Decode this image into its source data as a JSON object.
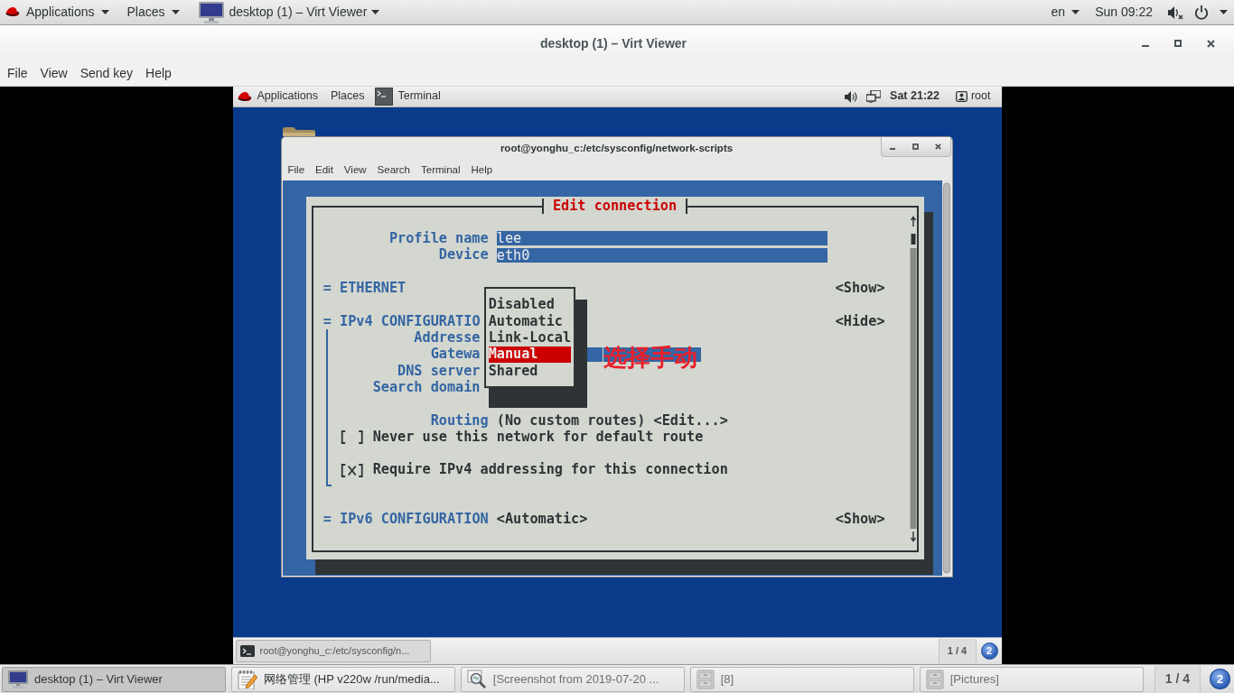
{
  "top_bar": {
    "applications": "Applications",
    "places": "Places",
    "window_menu": "desktop (1) – Virt Viewer",
    "keyboard": "en",
    "clock": "Sun 09:22"
  },
  "window": {
    "title": "desktop (1) – Virt Viewer",
    "menu": [
      "File",
      "View",
      "Send key",
      "Help"
    ]
  },
  "guest": {
    "top_bar": {
      "applications": "Applications",
      "places": "Places",
      "window_menu": "Terminal",
      "clock": "Sat 21:22",
      "user": "root"
    },
    "terminal": {
      "title": "root@yonghu_c:/etc/sysconfig/network-scripts",
      "menu": [
        "File",
        "Edit",
        "View",
        "Search",
        "Terminal",
        "Help"
      ],
      "dialog": {
        "title": "Edit connection",
        "fields": [
          {
            "label": "Profile name",
            "value": "lee"
          },
          {
            "label": "Device",
            "value": "eth0"
          }
        ],
        "ethernet": {
          "marker": "=",
          "label": "ETHERNET",
          "toggle": "<Show>"
        },
        "ipv4": {
          "marker": "=",
          "label": "IPv4 CONFIGURATIO",
          "toggle": "<Hide>",
          "rows": [
            {
              "kind": "label",
              "label": "Addresse"
            },
            {
              "kind": "field",
              "label": "Gatewa"
            },
            {
              "kind": "label",
              "label": "DNS server"
            },
            {
              "kind": "label",
              "label": "Search domain"
            }
          ],
          "routing": {
            "label": "Routing",
            "value": "(No custom routes)",
            "action": "<Edit...>"
          },
          "options": [
            {
              "label": "Never use this network for default route",
              "checked": false
            },
            {
              "label": "Require IPv4 addressing for this connection",
              "checked": true
            }
          ]
        },
        "ipv6": {
          "marker": "=",
          "label": "IPv6 CONFIGURATION",
          "value": "<Automatic>",
          "toggle": "<Show>"
        },
        "dropdown": {
          "options": [
            {
              "label": "Disabled",
              "selected": false
            },
            {
              "label": "Automatic",
              "selected": false
            },
            {
              "label": "Link-Local",
              "selected": false
            },
            {
              "label": "Manual",
              "selected": true
            },
            {
              "label": "Shared",
              "selected": false
            }
          ]
        }
      }
    },
    "annotation": "选择手动",
    "taskbar": {
      "tasks": [
        {
          "label": "root@yonghu_c:/etc/sysconfig/n..."
        }
      ],
      "workspace": "1 / 4",
      "notifications": "2"
    }
  },
  "taskbar": {
    "tasks": [
      {
        "label": "desktop (1) – Virt Viewer",
        "kind": "viewer",
        "selected": true,
        "minimized": false
      },
      {
        "label": "网络管理 (HP v220w /run/media...",
        "kind": "editor",
        "selected": false,
        "minimized": false
      },
      {
        "label": "[Screenshot from 2019-07-20 ...",
        "kind": "image",
        "selected": false,
        "minimized": true
      },
      {
        "label": "[8]",
        "kind": "files",
        "selected": false,
        "minimized": true
      },
      {
        "label": "[Pictures]",
        "kind": "files",
        "selected": false,
        "minimized": true
      }
    ],
    "workspace": "1 / 4",
    "notifications": "2"
  }
}
